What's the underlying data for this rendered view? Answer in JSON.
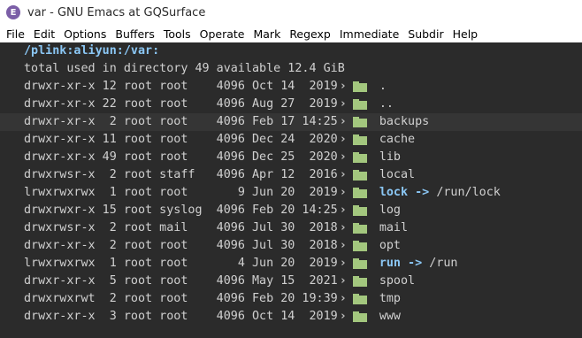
{
  "window": {
    "title": "var - GNU Emacs at GQSurface",
    "icon_letter": "E"
  },
  "menu": [
    "File",
    "Edit",
    "Options",
    "Buffers",
    "Tools",
    "Operate",
    "Mark",
    "Regexp",
    "Immediate",
    "Subdir",
    "Help"
  ],
  "dired": {
    "path": "/plink:aliyun:/var:",
    "summary": "total used in directory 49 available 12.4 GiB",
    "rows": [
      {
        "perm": "drwxr-xr-x",
        "links": "12",
        "user": "root",
        "group": "root",
        "size": "4096",
        "date": "Oct 14  2019",
        "name": ".",
        "link": false,
        "target": ""
      },
      {
        "perm": "drwxr-xr-x",
        "links": "22",
        "user": "root",
        "group": "root",
        "size": "4096",
        "date": "Aug 27  2019",
        "name": "..",
        "link": false,
        "target": ""
      },
      {
        "perm": "drwxr-xr-x",
        "links": "2",
        "user": "root",
        "group": "root",
        "size": "4096",
        "date": "Feb 17 14:25",
        "name": "backups",
        "link": false,
        "target": ""
      },
      {
        "perm": "drwxr-xr-x",
        "links": "11",
        "user": "root",
        "group": "root",
        "size": "4096",
        "date": "Dec 24  2020",
        "name": "cache",
        "link": false,
        "target": ""
      },
      {
        "perm": "drwxr-xr-x",
        "links": "49",
        "user": "root",
        "group": "root",
        "size": "4096",
        "date": "Dec 25  2020",
        "name": "lib",
        "link": false,
        "target": ""
      },
      {
        "perm": "drwxrwsr-x",
        "links": "2",
        "user": "root",
        "group": "staff",
        "size": "4096",
        "date": "Apr 12  2016",
        "name": "local",
        "link": false,
        "target": ""
      },
      {
        "perm": "lrwxrwxrwx",
        "links": "1",
        "user": "root",
        "group": "root",
        "size": "9",
        "date": "Jun 20  2019",
        "name": "lock",
        "link": true,
        "target": "/run/lock"
      },
      {
        "perm": "drwxrwxr-x",
        "links": "15",
        "user": "root",
        "group": "syslog",
        "size": "4096",
        "date": "Feb 20 14:25",
        "name": "log",
        "link": false,
        "target": ""
      },
      {
        "perm": "drwxrwsr-x",
        "links": "2",
        "user": "root",
        "group": "mail",
        "size": "4096",
        "date": "Jul 30  2018",
        "name": "mail",
        "link": false,
        "target": ""
      },
      {
        "perm": "drwxr-xr-x",
        "links": "2",
        "user": "root",
        "group": "root",
        "size": "4096",
        "date": "Jul 30  2018",
        "name": "opt",
        "link": false,
        "target": ""
      },
      {
        "perm": "lrwxrwxrwx",
        "links": "1",
        "user": "root",
        "group": "root",
        "size": "4",
        "date": "Jun 20  2019",
        "name": "run",
        "link": true,
        "target": "/run"
      },
      {
        "perm": "drwxr-xr-x",
        "links": "5",
        "user": "root",
        "group": "root",
        "size": "4096",
        "date": "May 15  2021",
        "name": "spool",
        "link": false,
        "target": ""
      },
      {
        "perm": "drwxrwxrwt",
        "links": "2",
        "user": "root",
        "group": "root",
        "size": "4096",
        "date": "Feb 20 19:39",
        "name": "tmp",
        "link": false,
        "target": ""
      },
      {
        "perm": "drwxr-xr-x",
        "links": "3",
        "user": "root",
        "group": "root",
        "size": "4096",
        "date": "Oct 14  2019",
        "name": "www",
        "link": false,
        "target": ""
      }
    ]
  },
  "icons": {
    "app": "emacs-icon",
    "folder": "folder-icon",
    "expand": "chevron-right-icon"
  },
  "colors": {
    "background": "#2b2b2b",
    "text": "#d0d0d0",
    "link": "#8bc7f5",
    "folder": "#a3c77e"
  }
}
